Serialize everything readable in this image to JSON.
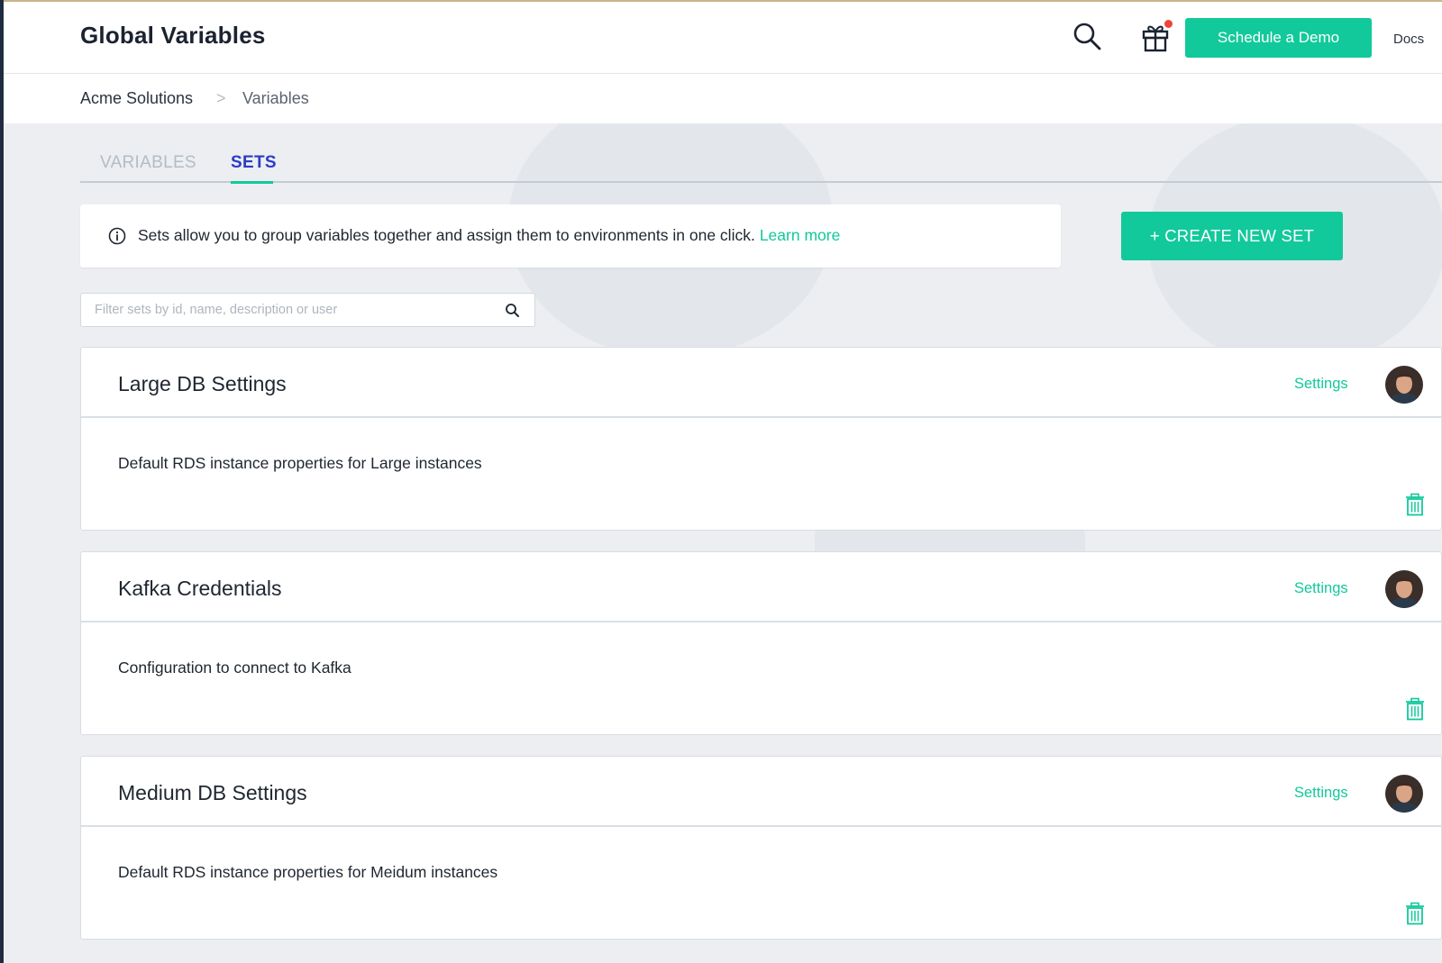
{
  "header": {
    "title": "Global Variables",
    "demo_button": "Schedule a Demo",
    "docs_link": "Docs"
  },
  "breadcrumb": {
    "items": [
      "Acme Solutions",
      "Variables"
    ],
    "separator": ">"
  },
  "tabs": [
    {
      "label": "VARIABLES",
      "active": false
    },
    {
      "label": "SETS",
      "active": true
    }
  ],
  "info": {
    "text": "Sets allow you to group variables together and assign them to environments in one click.",
    "link": "Learn more"
  },
  "create_button": "+ CREATE NEW SET",
  "filter": {
    "placeholder": "Filter sets by id, name, description or user",
    "value": ""
  },
  "sets": [
    {
      "name": "Large DB Settings",
      "description": "Default RDS instance properties for Large instances",
      "settings_label": "Settings"
    },
    {
      "name": "Kafka Credentials",
      "description": "Configuration to connect to Kafka",
      "settings_label": "Settings"
    },
    {
      "name": "Medium DB Settings",
      "description": "Default RDS instance properties for Meidum instances",
      "settings_label": "Settings"
    }
  ],
  "colors": {
    "accent": "#12c99b",
    "active_tab": "#2a3cc7",
    "notification": "#f0443a"
  }
}
